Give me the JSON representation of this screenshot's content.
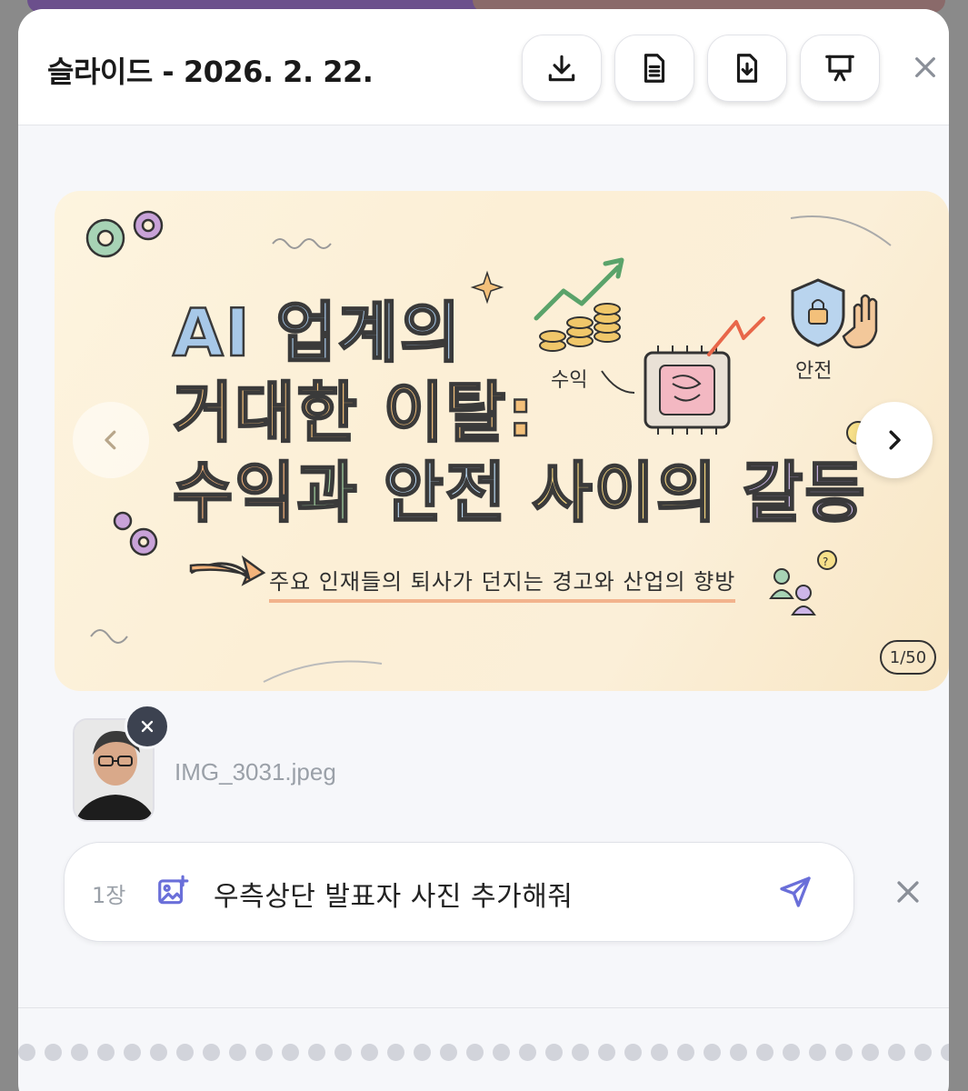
{
  "header": {
    "title": "슬라이드 - 2026. 2. 22.",
    "buttons": [
      {
        "name": "download-button",
        "icon": "download-icon"
      },
      {
        "name": "document-button",
        "icon": "document-icon"
      },
      {
        "name": "file-download-button",
        "icon": "file-download-icon"
      },
      {
        "name": "presentation-button",
        "icon": "presentation-icon"
      }
    ],
    "close_icon": "close-icon"
  },
  "slide": {
    "title_line1": "AI 업계의",
    "title_line2": "거대한 이탈:",
    "title_line3_parts": [
      "수익",
      "과",
      " 안전",
      " 사이의",
      " 갈등"
    ],
    "subtitle": "주요 인재들의 퇴사가 던지는 경고와 산업의 향방",
    "label_income": "수익",
    "label_safety": "안전",
    "page_badge": "1/50",
    "prev_icon": "chevron-left-icon",
    "next_icon": "chevron-right-icon"
  },
  "attachment": {
    "file_name": "IMG_3031.jpeg",
    "remove_icon": "close-icon"
  },
  "composer": {
    "slide_ref": "1장",
    "text": "우측상단 발표자 사진 추가해줘",
    "image_icon": "add-image-icon",
    "send_icon": "send-icon",
    "clear_icon": "close-icon"
  },
  "colors": {
    "accent": "#6a6fd9",
    "slide_bg": "#fcefd6",
    "modal_bg": "#f6f7fa"
  }
}
